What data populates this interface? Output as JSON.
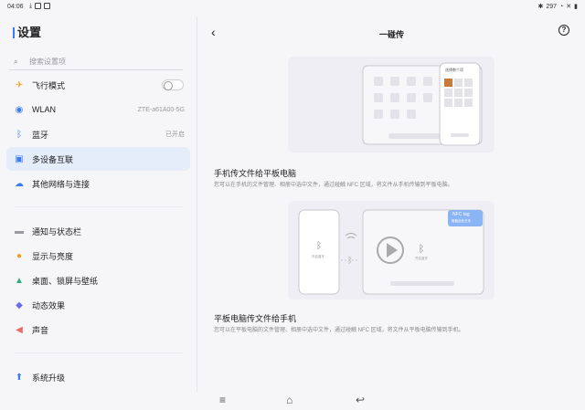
{
  "status": {
    "time": "04:06",
    "right_text": "297"
  },
  "sidebar": {
    "title": "设置",
    "search_placeholder": "搜索设置项",
    "items": [
      {
        "label": "飞行模式",
        "icon": "airplane-icon",
        "color": "#f0a020"
      },
      {
        "label": "WLAN",
        "value": "ZTE-a61A00-5G",
        "icon": "wifi-icon",
        "color": "#3a7bfa"
      },
      {
        "label": "蓝牙",
        "value": "已开启",
        "icon": "bluetooth-icon",
        "color": "#3a7bfa"
      },
      {
        "label": "多设备互联",
        "icon": "multi-device-icon",
        "color": "#3a7bfa"
      },
      {
        "label": "其他网络与连接",
        "icon": "cloud-icon",
        "color": "#3a7bfa"
      },
      {
        "label": "通知与状态栏",
        "icon": "notification-icon",
        "color": "#9a9aa0"
      },
      {
        "label": "显示与亮度",
        "icon": "sun-icon",
        "color": "#f0a020"
      },
      {
        "label": "桌面、锁屏与壁纸",
        "icon": "wallpaper-icon",
        "color": "#2ab07a"
      },
      {
        "label": "动态效果",
        "icon": "animation-icon",
        "color": "#6a6af0"
      },
      {
        "label": "声音",
        "icon": "speaker-icon",
        "color": "#f06a6a"
      },
      {
        "label": "系统升级",
        "icon": "upgrade-icon",
        "color": "#3a7bfa"
      }
    ]
  },
  "main": {
    "title": "一碰传",
    "section1": {
      "title": "手机传文件给平板电脑",
      "desc": "您可以在手机的文件管理、相册中选中文件，通过碰触 NFC 区域，将文件从手机传输到平板电脑。",
      "phone_header": "选择数个项"
    },
    "section2": {
      "title": "平板电脑传文件给手机",
      "desc": "您可以在平板电脑的文件管理、相册中选中文件，通过碰触 NFC 区域，将文件从平板电脑传输到手机。",
      "nfc_label": "NFC tag",
      "nfc_sub": "碰触此处互传",
      "phone_bt_label": "开启蓝牙",
      "tablet_bt_label": "开启蓝牙"
    }
  }
}
